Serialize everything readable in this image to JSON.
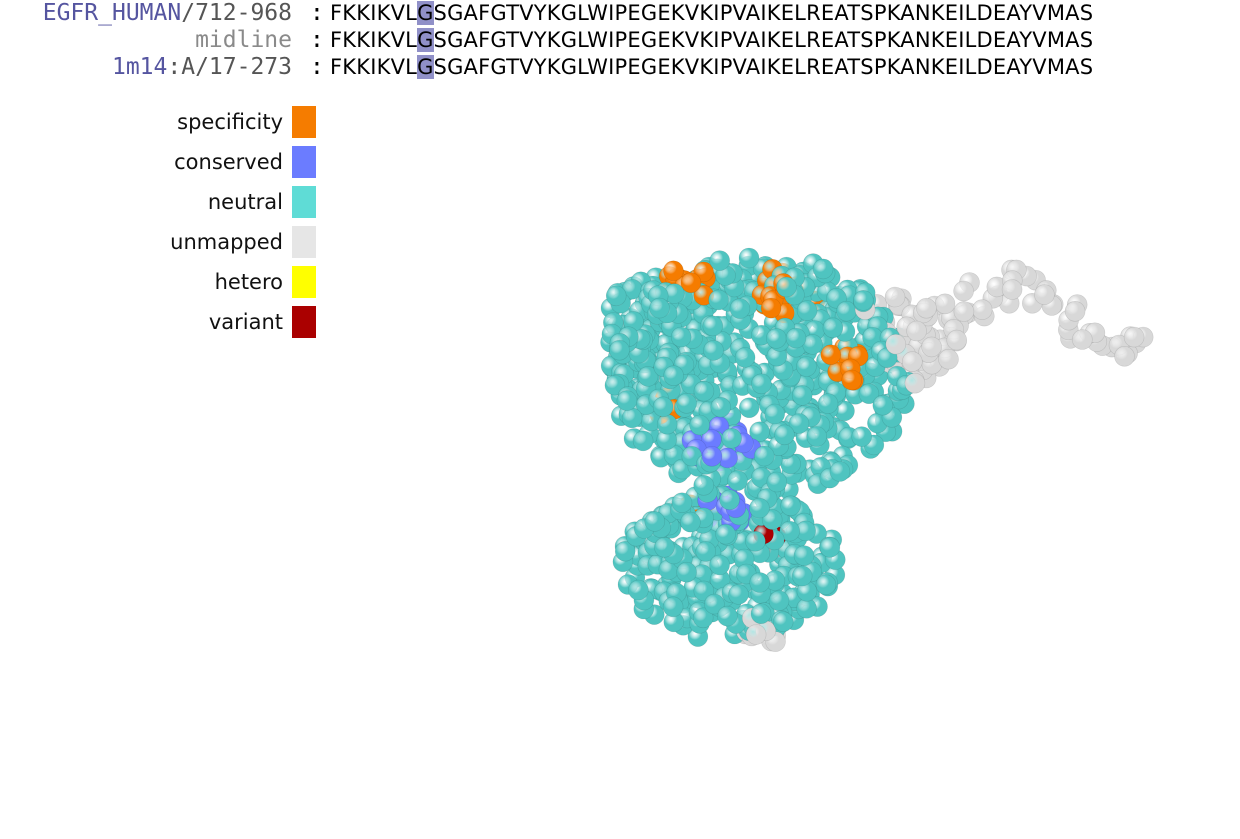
{
  "alignment": {
    "rows": [
      {
        "name": "EGFR_HUMAN",
        "range": "/712-968",
        "seq_pre": "FKKIKVL",
        "seq_hl": "G",
        "seq_post": "SGAFGTVYKGLWIPEGEKVKIPVAIKELREATSPKANKEILDEAYVMAS"
      },
      {
        "name": "",
        "range": "midline",
        "seq_pre": "FKKIKVL",
        "seq_hl": "G",
        "seq_post": "SGAFGTVYKGLWIPEGEKVKIPVAIKELREATSPKANKEILDEAYVMAS"
      },
      {
        "name": "1m14",
        "range": ":A/17-273",
        "seq_pre": "FKKIKVL",
        "seq_hl": "G",
        "seq_post": "SGAFGTVYKGLWIPEGEKVKIPVAIKELREATSPKANKEILDEAYVMAS"
      }
    ],
    "separator": ":"
  },
  "legend": [
    {
      "label": "specificity",
      "color": "#f57c00"
    },
    {
      "label": "conserved",
      "color": "#6b7cff"
    },
    {
      "label": "neutral",
      "color": "#5fdcd6"
    },
    {
      "label": "unmapped",
      "color": "#e6e6e6"
    },
    {
      "label": "hetero",
      "color": "#ffff00"
    },
    {
      "label": "variant",
      "color": "#aa0000"
    }
  ],
  "colors": {
    "highlight": "#9090c8",
    "neutral": "#4fc4c0",
    "specificity": "#f57c00",
    "conserved": "#6b7cff",
    "unmapped": "#d8d8d8",
    "variant": "#aa0000"
  }
}
